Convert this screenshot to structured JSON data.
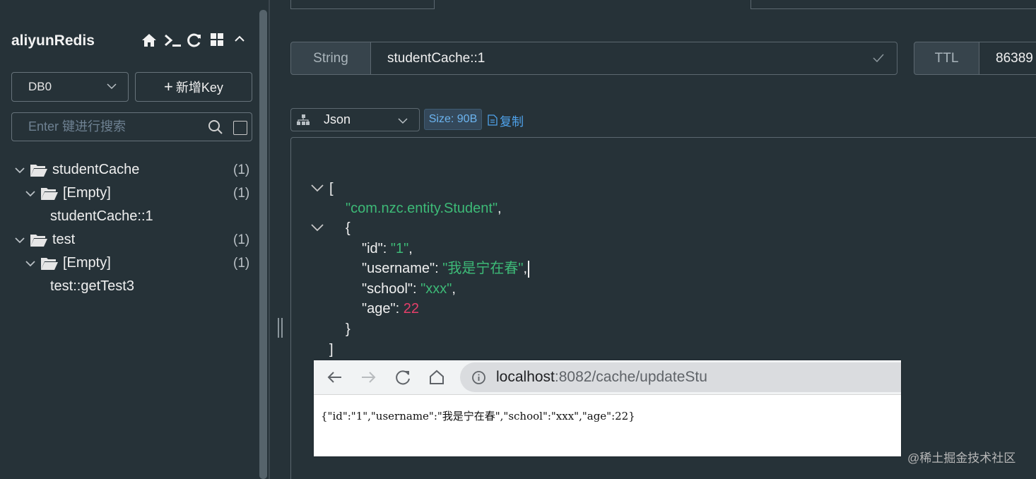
{
  "sidebar": {
    "app_title": "aliyunRedis",
    "header_icons": [
      "home-icon",
      "terminal-icon",
      "refresh-icon",
      "grid-icon",
      "chevron-up-icon"
    ],
    "db_select": "DB0",
    "add_key_label": "新增Key",
    "search_placeholder": "Enter 键进行搜索",
    "tree": [
      {
        "label": "studentCache",
        "count": "(1)"
      },
      {
        "label": "[Empty]",
        "count": "(1)"
      },
      {
        "label": "studentCache::1"
      },
      {
        "label": "test",
        "count": "(1)"
      },
      {
        "label": "[Empty]",
        "count": "(1)"
      },
      {
        "label": "test::getTest3"
      }
    ]
  },
  "key_header": {
    "type": "String",
    "key_name": "studentCache::1",
    "ttl_label": "TTL",
    "ttl_value": "86389"
  },
  "value_toolbar": {
    "format": "Json",
    "size": "Size: 90B",
    "copy_label": "复制"
  },
  "editor": {
    "open_bracket": "[",
    "class_name": "\"com.nzc.entity.Student\"",
    "open_brace": "{",
    "fields": {
      "id_key": "\"id\"",
      "id_value": "\"1\"",
      "username_key": "\"username\"",
      "username_value": "\"我是宁在春\"",
      "school_key": "\"school\"",
      "school_value": "\"xxx\"",
      "age_key": "\"age\"",
      "age_value": "22"
    },
    "close_brace": "}",
    "close_bracket": "]"
  },
  "browser": {
    "url_host": "localhost",
    "url_rest": ":8082/cache/updateStu",
    "body": "{\"id\":\"1\",\"username\":\"我是宁在春\",\"school\":\"xxx\",\"age\":22}"
  },
  "watermark": "@稀土掘金技术社区"
}
